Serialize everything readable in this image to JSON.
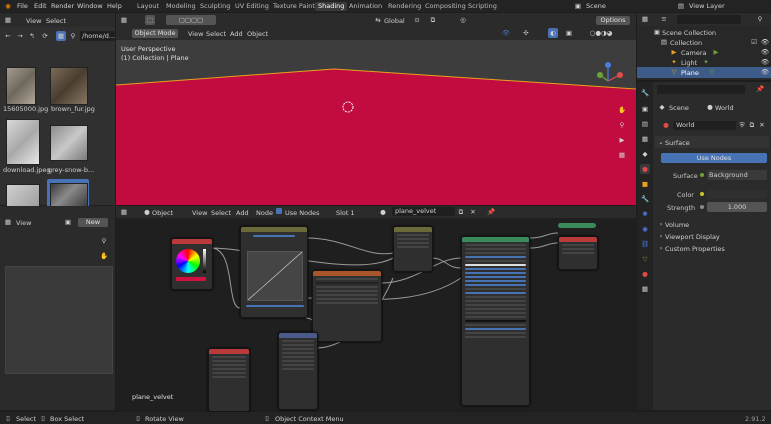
{
  "topbar": {
    "menus": [
      "File",
      "Edit",
      "Render",
      "Window",
      "Help"
    ],
    "workspaces": [
      "Layout",
      "Modeling",
      "Sculpting",
      "UV Editing",
      "Texture Paint",
      "Shading",
      "Animation",
      "Rendering",
      "Compositing",
      "Scripting"
    ],
    "active_workspace": "Shading",
    "scene": "Scene",
    "view_layer": "View Layer"
  },
  "file_browser": {
    "menus": [
      "View",
      "Select"
    ],
    "path": "/home/d...",
    "files": [
      "15605000.jpg",
      "brown_fur.jpg",
      "download.jpeg",
      "grey-snow-b...",
      "",
      ""
    ]
  },
  "viewport": {
    "mode": "Object Mode",
    "menus": [
      "View",
      "Select",
      "Add",
      "Object"
    ],
    "orientation": "Global",
    "options_label": "Options",
    "overlay_title": "User Perspective",
    "overlay_subtitle": "(1) Collection | Plane"
  },
  "image_editor": {
    "view_label": "View",
    "new_label": "New"
  },
  "node_editor": {
    "object_label": "Object",
    "menus": [
      "View",
      "Select",
      "Add",
      "Node"
    ],
    "use_nodes_label": "Use Nodes",
    "slot": "Slot 1",
    "material": "plane_velvet",
    "material_footer": "plane_velvet"
  },
  "outliner": {
    "root": "Scene Collection",
    "collection": "Collection",
    "items": [
      "Camera",
      "Light",
      "Plane"
    ]
  },
  "properties": {
    "scene_label": "Scene",
    "world_label": "World",
    "world_name": "World",
    "surface_header": "Surface",
    "use_nodes_button": "Use Nodes",
    "surface_label": "Surface",
    "surface_value": "Background",
    "color_label": "Color",
    "strength_label": "Strength",
    "strength_value": "1.000",
    "sections": [
      "Volume",
      "Viewport Display",
      "Custom Properties"
    ]
  },
  "statusbar": {
    "select": "Select",
    "box_select": "Box Select",
    "rotate_view": "Rotate View",
    "context_menu": "Object Context Menu",
    "version": "2.91.2"
  },
  "colors": {
    "accent": "#4772b3",
    "plane": "#c20c3f",
    "selection_outline": "#e8a020"
  }
}
